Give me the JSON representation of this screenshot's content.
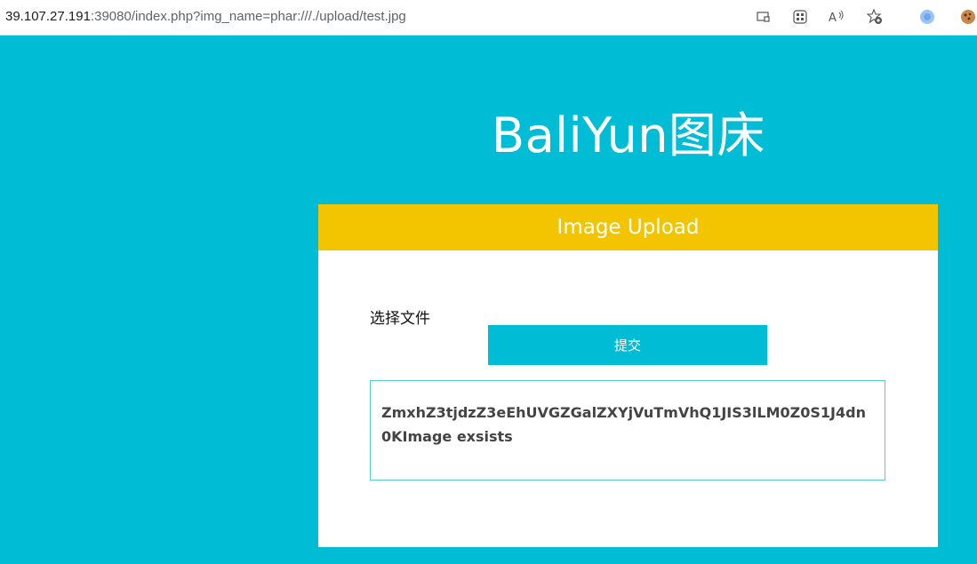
{
  "browser": {
    "url_host": "39.107.27.191",
    "url_rest": ":39080/index.php?img_name=phar:///./upload/test.jpg",
    "icons": [
      "tab-icon",
      "apps-icon",
      "read-aloud-icon",
      "favorite-add-icon",
      "profile-icon",
      "extension-icon"
    ]
  },
  "site": {
    "title": "BaliYun图床"
  },
  "panel": {
    "header": "Image Upload",
    "choose_file_label": "选择文件",
    "submit_label": "提交",
    "result_text": "ZmxhZ3tjdzZ3eEhUVGZGalZXYjVuTmVhQ1JIS3lLM0Z0S1J4dn0KImage exsists"
  }
}
